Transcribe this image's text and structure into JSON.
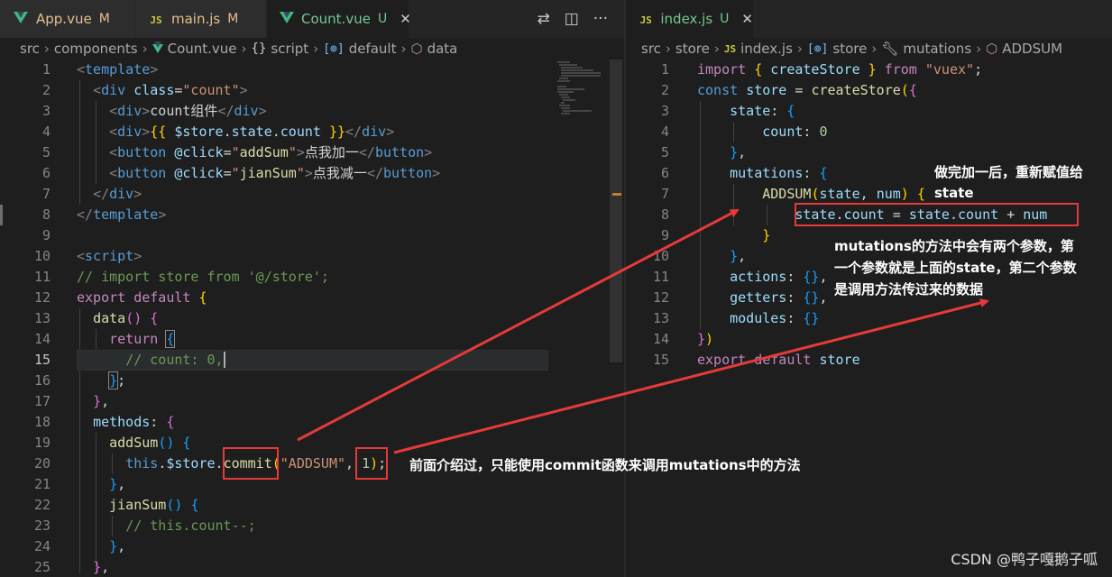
{
  "left": {
    "tabs": [
      {
        "icon": "vue-file-icon",
        "label": "App.vue",
        "status": "M"
      },
      {
        "icon": "js-file-icon",
        "label": "main.js",
        "status": "M"
      },
      {
        "icon": "vue-file-icon",
        "label": "Count.vue",
        "status": "U",
        "active": true
      }
    ],
    "breadcrumb": [
      "src",
      "components",
      "Count.vue",
      "script",
      "default",
      "data"
    ],
    "lines": [
      {
        "n": "1",
        "t": "<template>"
      },
      {
        "n": "2",
        "t": "<div class=\"count\">"
      },
      {
        "n": "3",
        "t": "<div>count组件</div>"
      },
      {
        "n": "4",
        "t": "<div>{{ $store.state.count }}</div>"
      },
      {
        "n": "5",
        "t": "<button @click=\"addSum\">点我加一</button>"
      },
      {
        "n": "6",
        "t": "<button @click=\"jianSum\">点我减一</button>"
      },
      {
        "n": "7",
        "t": "</div>"
      },
      {
        "n": "8",
        "t": "</template>"
      },
      {
        "n": "9",
        "t": ""
      },
      {
        "n": "10",
        "t": "<script>"
      },
      {
        "n": "11",
        "t": "// import store from '@/store';"
      },
      {
        "n": "12",
        "t": "export default {"
      },
      {
        "n": "13",
        "t": "data() {"
      },
      {
        "n": "14",
        "t": "return {"
      },
      {
        "n": "15",
        "t": "// count: 0,"
      },
      {
        "n": "16",
        "t": "};"
      },
      {
        "n": "17",
        "t": "},"
      },
      {
        "n": "18",
        "t": "methods: {"
      },
      {
        "n": "19",
        "t": "addSum() {"
      },
      {
        "n": "20",
        "t": "this.$store.commit(\"ADDSUM\", 1);"
      },
      {
        "n": "21",
        "t": "},"
      },
      {
        "n": "22",
        "t": "jianSum() {"
      },
      {
        "n": "23",
        "t": "// this.count--;"
      },
      {
        "n": "24",
        "t": "},"
      },
      {
        "n": "25",
        "t": "},"
      }
    ]
  },
  "right": {
    "tabs": [
      {
        "icon": "js-file-icon",
        "label": "index.js",
        "status": "U",
        "active": true
      }
    ],
    "breadcrumb": [
      "src",
      "store",
      "index.js",
      "store",
      "mutations",
      "ADDSUM"
    ],
    "lines": [
      {
        "n": "1",
        "t": "import { createStore } from \"vuex\";"
      },
      {
        "n": "2",
        "t": "const store = createStore({"
      },
      {
        "n": "3",
        "t": "state: {"
      },
      {
        "n": "4",
        "t": "count: 0"
      },
      {
        "n": "5",
        "t": "},"
      },
      {
        "n": "6",
        "t": "mutations: {"
      },
      {
        "n": "7",
        "t": "ADDSUM(state, num) {"
      },
      {
        "n": "8",
        "t": "state.count = state.count + num"
      },
      {
        "n": "9",
        "t": "}"
      },
      {
        "n": "10",
        "t": "},"
      },
      {
        "n": "11",
        "t": "actions: {},"
      },
      {
        "n": "12",
        "t": "getters: {},"
      },
      {
        "n": "13",
        "t": "modules: {}"
      },
      {
        "n": "14",
        "t": "})"
      },
      {
        "n": "15",
        "t": "export default store"
      }
    ]
  },
  "annotations": {
    "reassign_line1": "做完加一后，重新赋值给",
    "reassign_line2": "state",
    "params_line1": "mutations的方法中会有两个参数，第",
    "params_line2": "一个参数就是上面的state，第二个参数",
    "params_line3": "是调用方法传过来的数据",
    "commit_note": "前面介绍过，只能使用commit函数来调用mutations中的方法"
  },
  "watermark": "CSDN @鸭子嘎鹅子呱",
  "colors": {
    "highlight_box": "#e53a3a",
    "arrow": "#e53a3a",
    "editor_bg": "#1e1e1e"
  }
}
